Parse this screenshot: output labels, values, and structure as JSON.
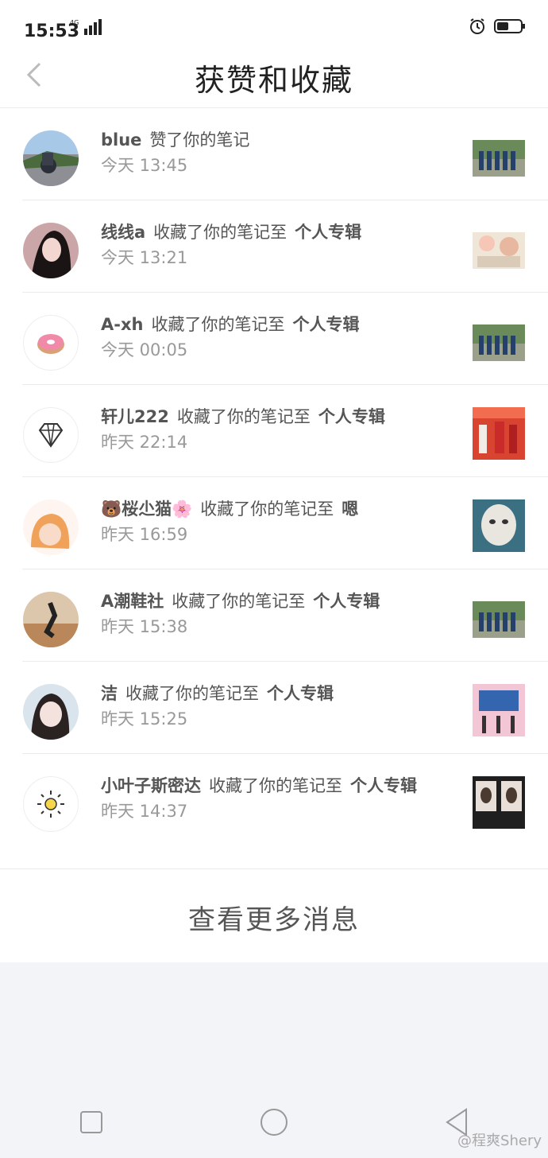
{
  "status": {
    "time": "15:53"
  },
  "header": {
    "title": "获赞和收藏"
  },
  "notifications": [
    {
      "name": "blue",
      "action": "赞了你的笔记",
      "album": "",
      "time": "今天 13:45"
    },
    {
      "name": "线线a",
      "action": "收藏了你的笔记至",
      "album": "个人专辑",
      "time": "今天 13:21"
    },
    {
      "name": "A-xh",
      "action": "收藏了你的笔记至",
      "album": "个人专辑",
      "time": "今天 00:05"
    },
    {
      "name": "轩儿222",
      "action": "收藏了你的笔记至",
      "album": "个人专辑",
      "time": "昨天 22:14"
    },
    {
      "name": "🐻桜尐猫🌸",
      "action": "收藏了你的笔记至",
      "album": "嗯",
      "time": "昨天 16:59"
    },
    {
      "name": "A潮鞋社",
      "action": "收藏了你的笔记至",
      "album": "个人专辑",
      "time": "昨天 15:38"
    },
    {
      "name": "洁",
      "action": "收藏了你的笔记至",
      "album": "个人专辑",
      "time": "昨天 15:25"
    },
    {
      "name": "小叶子斯密达",
      "action": "收藏了你的笔记至",
      "album": "个人专辑",
      "time": "昨天 14:37"
    }
  ],
  "footer": {
    "more_label": "查看更多消息"
  },
  "watermark": "@程爽Shery",
  "icons": {
    "back": "chevron-left-icon",
    "alarm": "alarm-icon",
    "battery": "battery-icon",
    "nav_square": "recent-apps-icon",
    "nav_circle": "home-icon",
    "nav_triangle": "back-triangle-icon"
  }
}
